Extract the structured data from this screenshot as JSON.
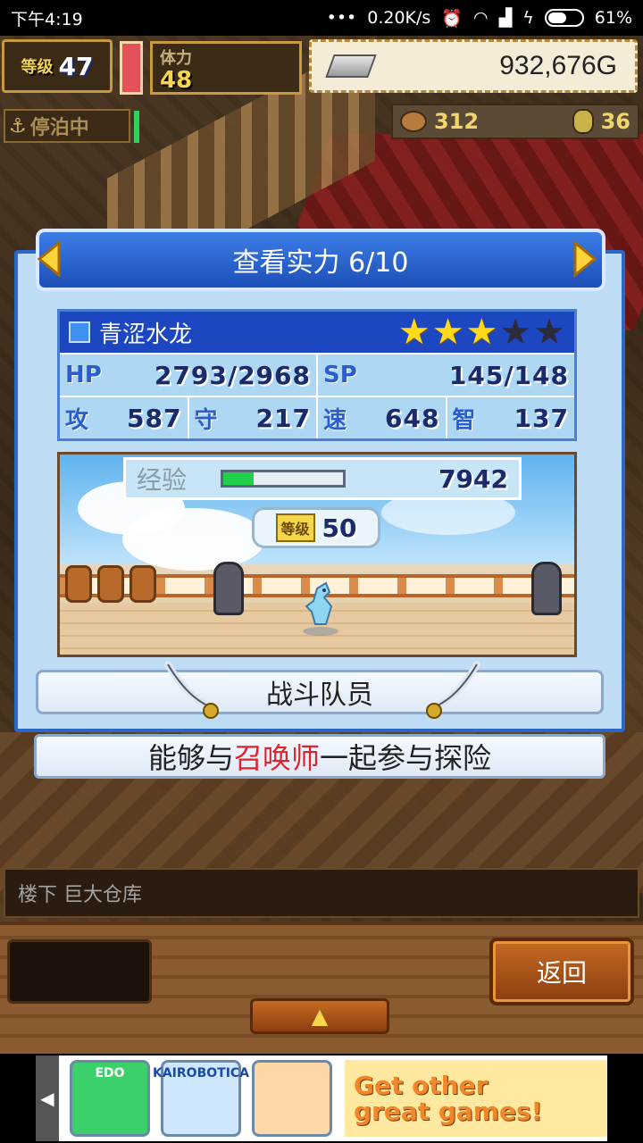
{
  "status_bar": {
    "time": "下午4:19",
    "dots": "•••",
    "net_speed": "0.20K/s",
    "battery": "61%",
    "battery_level": 0.61
  },
  "hud": {
    "level_label": "等级",
    "level_value": "47",
    "stamina_label": "体力",
    "stamina_value": "48",
    "gold_value": "932,676G",
    "dock_status": "停泊中",
    "resource_1": "312",
    "resource_2": "36"
  },
  "dialog": {
    "title": "查看实力 6/10",
    "unit_name": "青涩水龙",
    "stars_filled": 3,
    "stars_total": 5,
    "hp_label": "HP",
    "hp_value": "2793/2968",
    "sp_label": "SP",
    "sp_value": "145/148",
    "atk_label": "攻",
    "atk_value": "587",
    "def_label": "守",
    "def_value": "217",
    "spd_label": "速",
    "spd_value": "648",
    "int_label": "智",
    "int_value": "137",
    "exp_label": "经验",
    "exp_value": "7942",
    "exp_progress": 0.25,
    "level_label": "等级",
    "level_value": "50",
    "role": "战斗队员",
    "desc_before": "能够与",
    "desc_highlight": "召唤师",
    "desc_after": "一起参与探险"
  },
  "bottom": {
    "location": "楼下 巨大仓库",
    "back_label": "返回",
    "up_label": "▲"
  },
  "ad": {
    "game1": "EDO",
    "game2": "KAIROBOTICA",
    "promo_line1": "Get other",
    "promo_line2": "great games!"
  },
  "colors": {
    "title_blue": "#1c4fb8",
    "star_gold": "#ffd91a",
    "highlight_red": "#e0232b",
    "exp_green": "#1fd14a"
  }
}
